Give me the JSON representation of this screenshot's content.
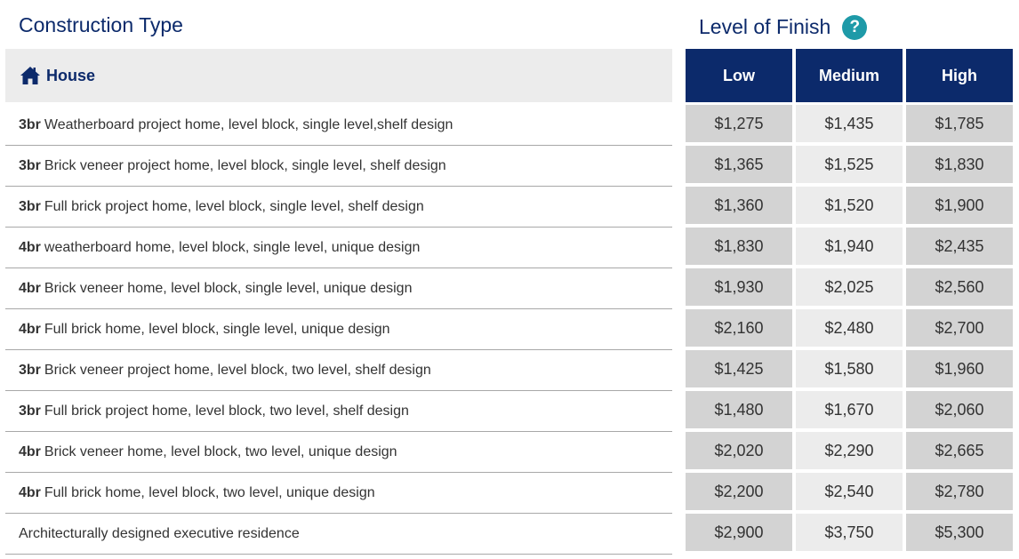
{
  "construction_title": "Construction Type",
  "level_title": "Level of Finish",
  "help_icon": "?",
  "house_label": "House",
  "levels": [
    "Low",
    "Medium",
    "High"
  ],
  "rows": [
    {
      "beds": "3br",
      "desc": "Weatherboard project home, level block, single level,shelf design",
      "low": "$1,275",
      "medium": "$1,435",
      "high": "$1,785"
    },
    {
      "beds": "3br",
      "desc": "Brick veneer project home, level block, single level, shelf design",
      "low": "$1,365",
      "medium": "$1,525",
      "high": "$1,830"
    },
    {
      "beds": "3br",
      "desc": "Full brick project home, level block, single level, shelf design",
      "low": "$1,360",
      "medium": "$1,520",
      "high": "$1,900"
    },
    {
      "beds": "4br",
      "desc": "weatherboard home, level block, single level, unique design",
      "low": "$1,830",
      "medium": "$1,940",
      "high": "$2,435"
    },
    {
      "beds": "4br",
      "desc": "Brick veneer home, level block, single level, unique design",
      "low": "$1,930",
      "medium": "$2,025",
      "high": "$2,560"
    },
    {
      "beds": "4br",
      "desc": "Full brick home, level block, single level, unique design",
      "low": "$2,160",
      "medium": "$2,480",
      "high": "$2,700"
    },
    {
      "beds": "3br",
      "desc": "Brick veneer project home, level block, two level, shelf design",
      "low": "$1,425",
      "medium": "$1,580",
      "high": "$1,960"
    },
    {
      "beds": "3br",
      "desc": "Full brick project home, level block, two level, shelf design",
      "low": "$1,480",
      "medium": "$1,670",
      "high": "$2,060"
    },
    {
      "beds": "4br",
      "desc": "Brick veneer home, level block, two level, unique design",
      "low": "$2,020",
      "medium": "$2,290",
      "high": "$2,665"
    },
    {
      "beds": "4br",
      "desc": "Full brick home, level block, two level, unique design",
      "low": "$2,200",
      "medium": "$2,540",
      "high": "$2,780"
    },
    {
      "beds": "",
      "desc": "Architecturally designed executive residence",
      "low": "$2,900",
      "medium": "$3,750",
      "high": "$5,300"
    }
  ],
  "colors": {
    "navy": "#0c2a6b",
    "teal": "#1e9aa8",
    "cell_dark": "#d3d3d3",
    "cell_light": "#ececec"
  }
}
